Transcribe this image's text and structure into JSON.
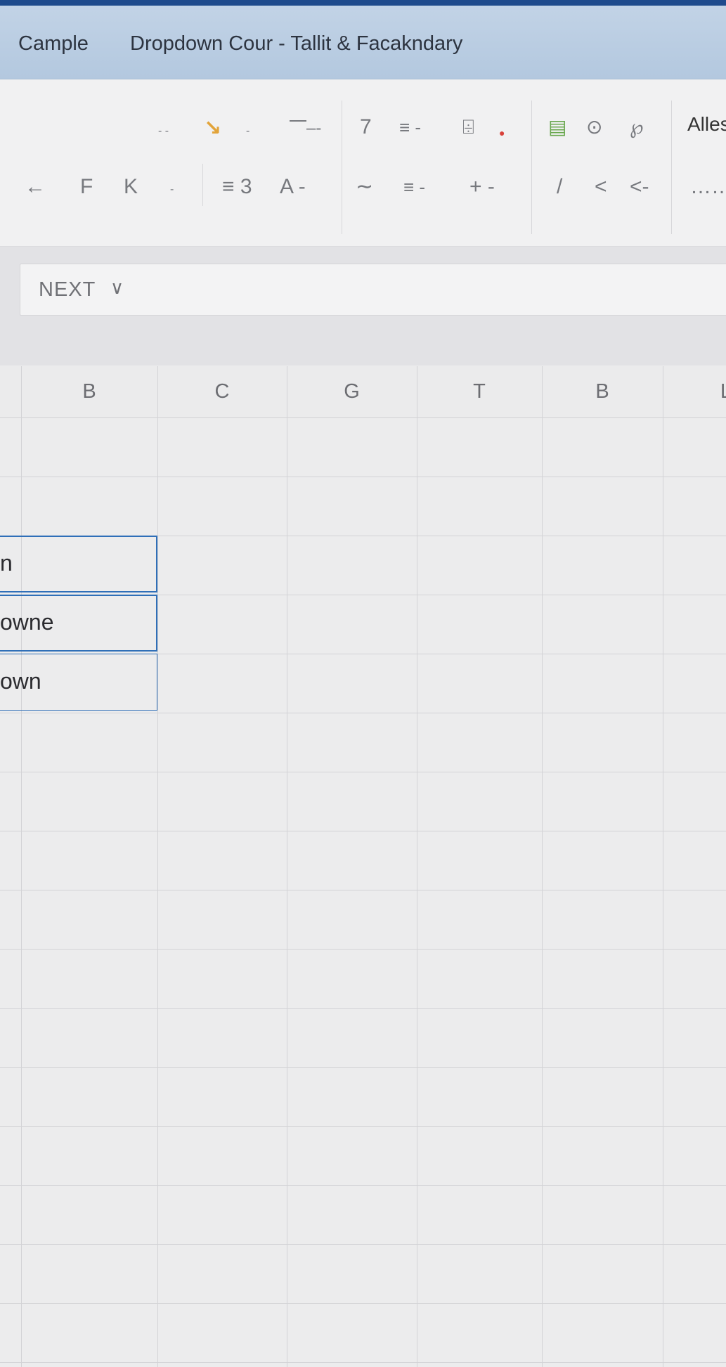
{
  "window": {
    "title_left": "Cample",
    "title_main": "Dropdown Cour - Tallit & Facakndary"
  },
  "ribbon": {
    "row1": {
      "g1": "- -",
      "g1_orange": "↘",
      "g1_drop": "-",
      "g2": "⎺–-",
      "g3": "7",
      "g4": "≡ -",
      "g5": "⌹",
      "g6": "⊙",
      "g7": "℘",
      "alles": "Alles"
    },
    "row2": {
      "b1": "←",
      "b2": "F",
      "b3": "K",
      "b4": "-",
      "b5": "≡ 3",
      "b6": "A -",
      "b7": "∼",
      "b8": "≡ -",
      "b9": "+ -",
      "b10": "/",
      "b11": "<",
      "b12": "<-",
      "b13": "……"
    }
  },
  "namebox": {
    "value": "NEXT",
    "chevron": "∨"
  },
  "sheet": {
    "columns": [
      "B",
      "C",
      "G",
      "T",
      "B",
      "L"
    ],
    "cells": [
      "n",
      "owne",
      "own"
    ]
  }
}
